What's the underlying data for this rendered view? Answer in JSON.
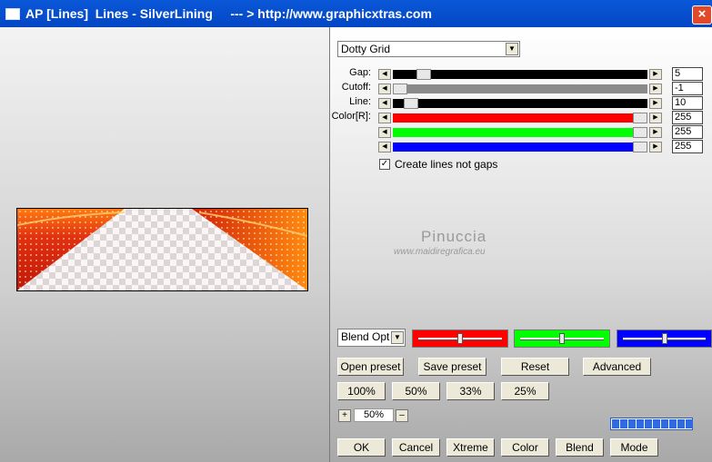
{
  "window": {
    "title": "AP [Lines]  Lines - SilverLining     --- > http://www.graphicxtras.com",
    "close_glyph": "×"
  },
  "preview": {
    "description": "lines effect preview"
  },
  "effect": {
    "selected": "Dotty Grid"
  },
  "params": [
    {
      "label": "Gap:",
      "value": "5",
      "fill": 0.04
    },
    {
      "label": "Cutoff:",
      "value": "-1",
      "fill": 0.0
    },
    {
      "label": "Line:",
      "value": "10",
      "fill": 0.02
    },
    {
      "label": "Color[R]:",
      "value": "255",
      "fill": 1.0,
      "color": "#ff0000"
    },
    {
      "label": "",
      "value": "255",
      "fill": 1.0,
      "color": "#00ff00"
    },
    {
      "label": "",
      "value": "255",
      "fill": 1.0,
      "color": "#0000ff"
    }
  ],
  "checkbox": {
    "label": "Create lines not gaps",
    "checked": true,
    "mark": "✓"
  },
  "watermark": {
    "line1": "Pinuccia",
    "line2": "www.maidiregrafica.eu"
  },
  "blend": {
    "selected": "Blend Optio"
  },
  "color_sliders": [
    {
      "color": "#ff0000",
      "position": 0.5
    },
    {
      "color": "#00ff00",
      "position": 0.5
    },
    {
      "color": "#0000ff",
      "position": 0.5
    }
  ],
  "buttons": {
    "open_preset": "Open preset",
    "save_preset": "Save preset",
    "reset": "Reset",
    "advanced": "Advanced",
    "zoom_100": "100%",
    "zoom_50": "50%",
    "zoom_33": "33%",
    "zoom_25": "25%",
    "ok": "OK",
    "cancel": "Cancel",
    "xtreme": "Xtreme",
    "color": "Color",
    "blend": "Blend",
    "mode": "Mode"
  },
  "zoom": {
    "plus": "+",
    "minus": "–",
    "value": "50%"
  },
  "progress": {
    "segments": 10,
    "filled": 10
  },
  "colors": {
    "titlebar": "#0a58d8",
    "red": "#ff0000",
    "green": "#00ff00",
    "blue": "#0000ff"
  }
}
